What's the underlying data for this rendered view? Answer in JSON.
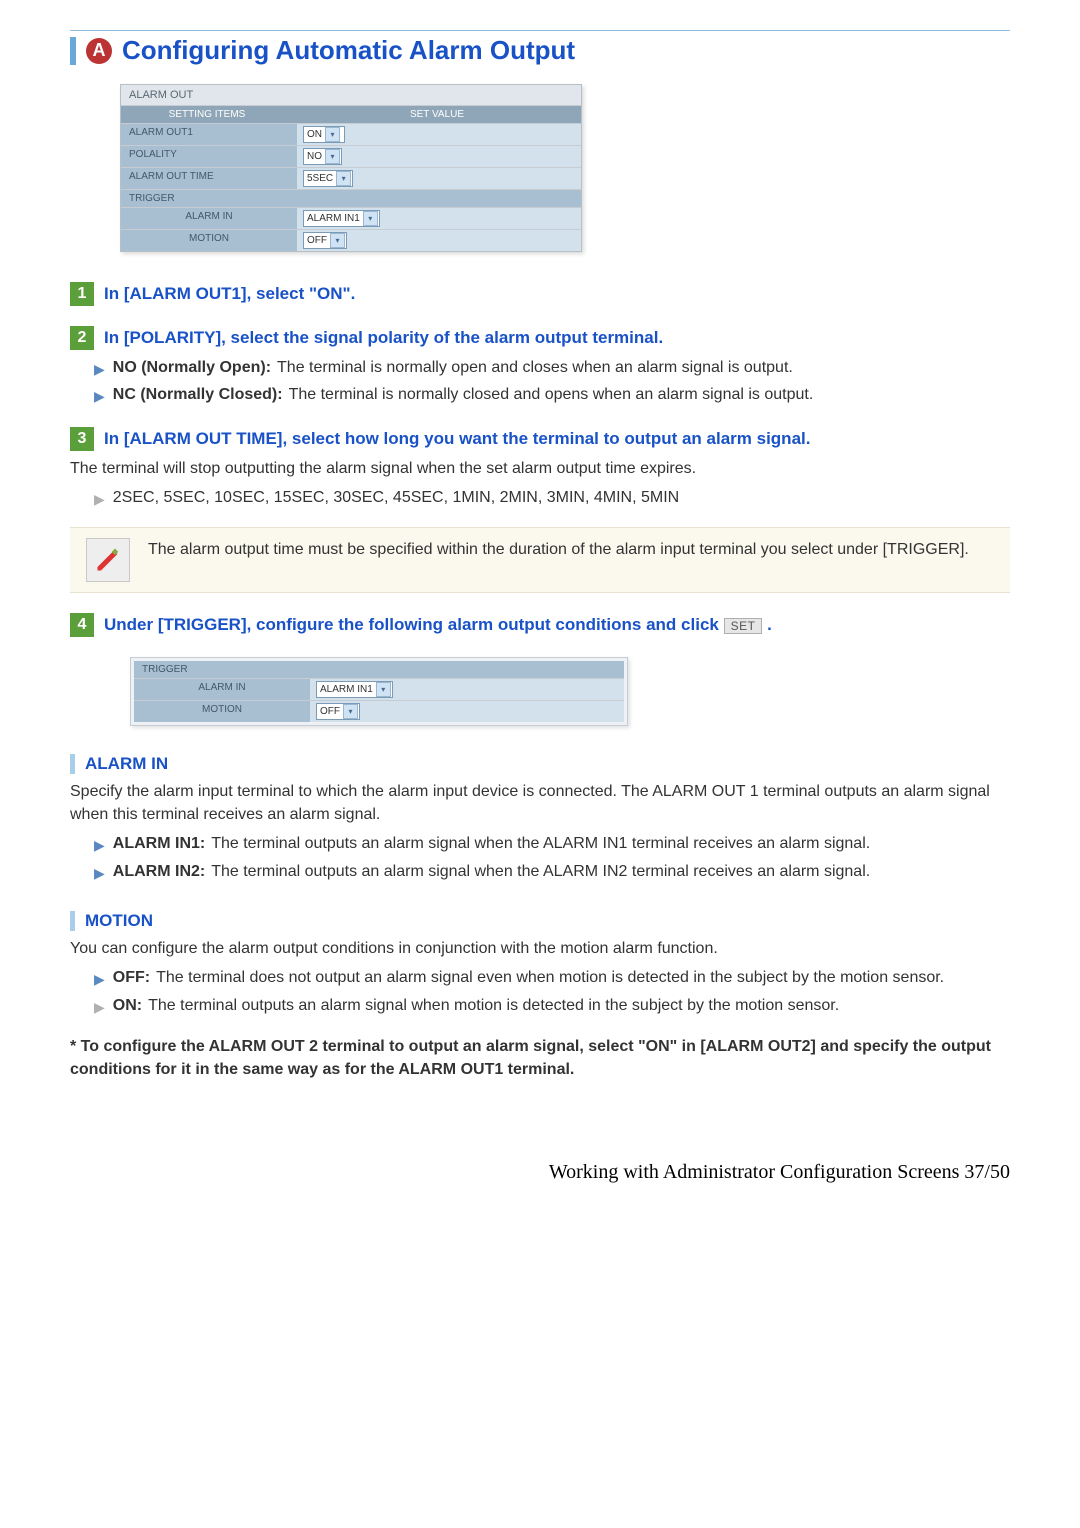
{
  "title": {
    "letter": "A",
    "text": "Configuring Automatic Alarm Output"
  },
  "alarm_out_table": {
    "caption": "ALARM OUT",
    "header_items": "SETTING ITEMS",
    "header_value": "SET VALUE",
    "rows": {
      "alarm_out1_label": "ALARM OUT1",
      "alarm_out1_value": "ON",
      "polarity_label": "POLALITY",
      "polarity_value": "NO",
      "time_label": "ALARM OUT TIME",
      "time_value": "5SEC",
      "trigger_label": "TRIGGER",
      "alarm_in_label": "ALARM IN",
      "alarm_in_value": "ALARM IN1",
      "motion_label": "MOTION",
      "motion_value": "OFF"
    }
  },
  "steps": {
    "s1": "In [ALARM OUT1], select \"ON\".",
    "s2": "In [POLARITY], select the signal polarity of the alarm output terminal.",
    "s2_bullets": {
      "no_label": "NO (Normally Open):",
      "no_text": "The terminal is normally open and closes when an alarm signal is output.",
      "nc_label": "NC (Normally Closed):",
      "nc_text": "The terminal is normally closed and opens when an alarm signal is output."
    },
    "s3": "In [ALARM OUT TIME], select how long you want the terminal to output an alarm signal.",
    "s3_body": "The terminal will stop outputting the alarm signal when the set alarm output time expires.",
    "s3_options": "2SEC, 5SEC, 10SEC, 15SEC, 30SEC, 45SEC, 1MIN, 2MIN, 3MIN, 4MIN, 5MIN",
    "s3_note": "The alarm output time must be specified within the duration of the alarm input terminal you select under [TRIGGER].",
    "s4_prefix": "Under [TRIGGER], configure the following alarm output conditions and click ",
    "s4_button": "SET",
    "s4_suffix": " ."
  },
  "trigger_figure": {
    "caption": "TRIGGER",
    "alarm_in_label": "ALARM IN",
    "alarm_in_value": "ALARM IN1",
    "motion_label": "MOTION",
    "motion_value": "OFF"
  },
  "alarm_in_section": {
    "title": "ALARM IN",
    "body": "Specify the alarm input terminal to which the alarm input device is connected. The ALARM OUT 1 terminal outputs an alarm signal when this terminal receives an alarm signal.",
    "b1_label": "ALARM IN1:",
    "b1_text": "The terminal outputs an alarm signal when the ALARM IN1 terminal receives an alarm signal.",
    "b2_label": "ALARM IN2:",
    "b2_text": "The terminal outputs an alarm signal when the ALARM IN2 terminal receives an alarm signal."
  },
  "motion_section": {
    "title": "MOTION",
    "body": "You can configure the alarm output conditions in conjunction with the motion alarm function.",
    "off_label": "OFF:",
    "off_text": "The terminal does not output an alarm signal even when motion is detected in the subject by the motion sensor.",
    "on_label": "ON:",
    "on_text": "The terminal outputs an alarm signal when motion is detected in the subject by the motion sensor."
  },
  "footnote": "* To configure the ALARM OUT 2 terminal to output an alarm signal, select \"ON\" in [ALARM OUT2] and specify the output conditions for it in the same way as for the ALARM OUT1 terminal.",
  "footer": "Working with Administrator Configuration Screens 37/50"
}
